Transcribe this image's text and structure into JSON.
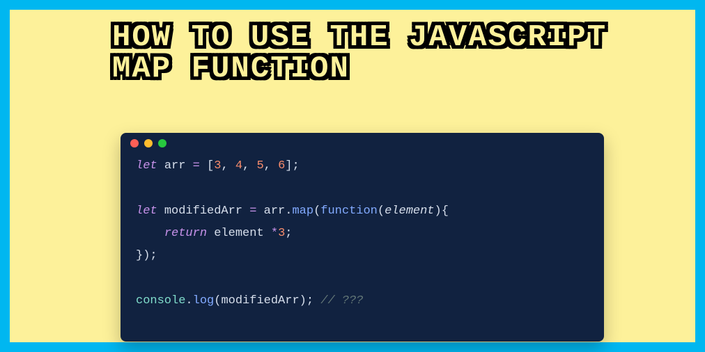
{
  "colors": {
    "frame": "#00b7f0",
    "panel": "#fdf19a",
    "editor_bg": "#112240",
    "traffic_red": "#ff5f56",
    "traffic_yellow": "#ffbd2e",
    "traffic_green": "#27c93f"
  },
  "title": "HOW TO USE THE JAVASCRIPT MAP FUNCTION",
  "code": {
    "line1": {
      "kw": "let",
      "var": "arr",
      "eq": " = ",
      "open": "[",
      "n1": "3",
      "c": ", ",
      "n2": "4",
      "n3": "5",
      "n4": "6",
      "close": "];"
    },
    "blank1": " ",
    "line2": {
      "kw": "let",
      "var": "modifiedArr",
      "eq": " = ",
      "obj": "arr",
      "dot": ".",
      "fn": "map",
      "open": "(",
      "kw2": "function",
      "open2": "(",
      "arg": "element",
      "close2": ")",
      "brace": "{"
    },
    "line3": {
      "indent": "    ",
      "ret": "return",
      "sp": " ",
      "arg": "element",
      "sp2": " ",
      "op": "*",
      "n": "3",
      "semi": ";"
    },
    "line4": {
      "close": "});"
    },
    "blank2": " ",
    "line5": {
      "obj": "console",
      "dot": ".",
      "fn": "log",
      "open": "(",
      "arg": "modifiedArr",
      "close": ");",
      "sp": " ",
      "cmt": "// ???"
    }
  }
}
